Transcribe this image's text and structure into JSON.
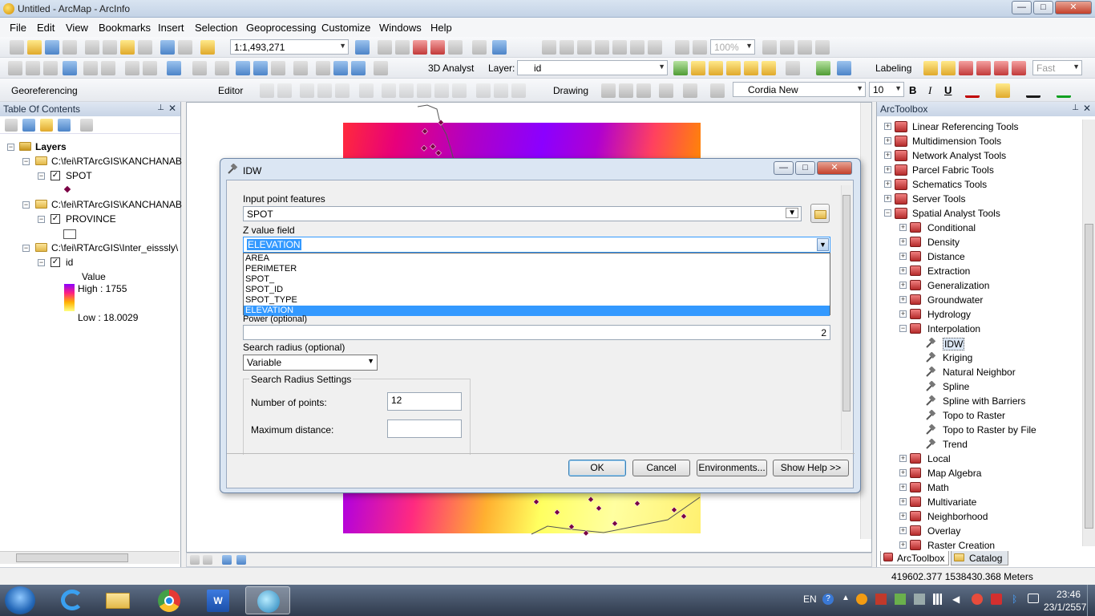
{
  "window": {
    "title": "Untitled - ArcMap - ArcInfo",
    "min": "—",
    "max": "□",
    "close": "✕"
  },
  "menu": [
    "File",
    "Edit",
    "View",
    "Bookmarks",
    "Insert",
    "Selection",
    "Geoprocessing",
    "Customize",
    "Windows",
    "Help"
  ],
  "toolbar1": {
    "scale": "1:1,493,271",
    "zoom_pct": "100%"
  },
  "toolbar2": {
    "analyst_3d": "3D Analyst",
    "layer_label": "Layer:",
    "layer_value": "id",
    "labeling": "Labeling",
    "fast": "Fast"
  },
  "toolbar3": {
    "georef": "Georeferencing",
    "editor": "Editor",
    "drawing": "Drawing",
    "font": "Cordia New",
    "font_size": "10",
    "bold": "B",
    "italic": "I",
    "underline": "U"
  },
  "toc": {
    "title": "Table Of Contents",
    "layers": "Layers",
    "group1": "C:\\fei\\RTArcGIS\\KANCHANAB",
    "spot": "SPOT",
    "group2": "C:\\fei\\RTArcGIS\\KANCHANAB",
    "province": "PROVINCE",
    "group3": "C:\\fei\\RTArcGIS\\Inter_eisssly\\",
    "id": "id",
    "value": "Value",
    "high": "High : 1755",
    "low": "Low : 18.0029"
  },
  "dialog": {
    "title": "IDW",
    "input_label": "Input point features",
    "input_value": "SPOT",
    "z_label": "Z value field",
    "z_value": "ELEVATION",
    "z_options": [
      "AREA",
      "PERIMETER",
      "SPOT_",
      "SPOT_ID",
      "SPOT_TYPE",
      "ELEVATION"
    ],
    "power_label": "Power (optional)",
    "power_value": "2",
    "radius_label": "Search radius (optional)",
    "radius_value": "Variable",
    "settings_label": "Search Radius Settings",
    "npoints_label": "Number of points:",
    "npoints_value": "12",
    "maxdist_label": "Maximum distance:",
    "ok": "OK",
    "cancel": "Cancel",
    "env": "Environments...",
    "help": "Show Help >>"
  },
  "arctoolbox": {
    "title": "ArcToolbox",
    "top_items": [
      "Linear Referencing Tools",
      "Multidimension Tools",
      "Network Analyst Tools",
      "Parcel Fabric Tools",
      "Schematics Tools",
      "Server Tools",
      "Spatial Analyst Tools"
    ],
    "spatial_children_a": [
      "Conditional",
      "Density",
      "Distance",
      "Extraction",
      "Generalization",
      "Groundwater",
      "Hydrology",
      "Interpolation"
    ],
    "interp_tools": [
      "IDW",
      "Kriging",
      "Natural Neighbor",
      "Spline",
      "Spline with Barriers",
      "Topo to Raster",
      "Topo to Raster by File",
      "Trend"
    ],
    "spatial_children_b": [
      "Local",
      "Map Algebra",
      "Math",
      "Multivariate",
      "Neighborhood",
      "Overlay",
      "Raster Creation"
    ],
    "tab1": "ArcToolbox",
    "tab2": "Catalog"
  },
  "status": {
    "coords": "419602.377  1538430.368 Meters"
  },
  "taskbar": {
    "lang": "EN",
    "time": "23:46",
    "date": "23/1/2557"
  },
  "colors": {
    "accent": "#3399ff",
    "raster_high": "#8b00ff",
    "raster_low": "#ffff80"
  }
}
